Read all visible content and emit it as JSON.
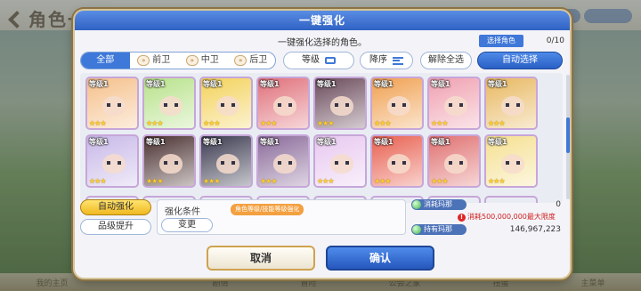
{
  "background": {
    "title": "角色一览",
    "bottom_nav": [
      "我的主页",
      "",
      "剧情",
      "冒险",
      "公会之家",
      "扭蛋",
      "主菜单"
    ]
  },
  "dialog": {
    "title": "一键强化",
    "subtitle": "一键强化选择的角色。",
    "select_label": "选择角色",
    "select_count": "0/10",
    "position_tabs": [
      {
        "label": "全部",
        "icon": ""
      },
      {
        "label": "前卫",
        "icon": "front-position-icon"
      },
      {
        "label": "中卫",
        "icon": "middle-position-icon"
      },
      {
        "label": "后卫",
        "icon": "back-position-icon"
      }
    ],
    "sort_key": "等级",
    "sort_order": "降序",
    "clear_all": "解除全选",
    "auto_select": "自动选择",
    "cards": [
      {
        "level": "等级1",
        "stars": "★★★",
        "color": "#f5c08a"
      },
      {
        "level": "等级1",
        "stars": "★★★",
        "color": "#b7e28a"
      },
      {
        "level": "等级1",
        "stars": "★★★",
        "color": "#f3d25a"
      },
      {
        "level": "等级1",
        "stars": "★★★",
        "color": "#e0707a"
      },
      {
        "level": "等级1",
        "stars": "★★★",
        "color": "#6a4a5a"
      },
      {
        "level": "等级1",
        "stars": "★★★",
        "color": "#f0a050"
      },
      {
        "level": "等级1",
        "stars": "★★★",
        "color": "#f0a0b0"
      },
      {
        "level": "等级1",
        "stars": "★★★",
        "color": "#e8b860"
      },
      {
        "level": "等级1",
        "stars": "★★★",
        "color": "#c8b8e8"
      },
      {
        "level": "等级1",
        "stars": "★★★",
        "color": "#4a3030"
      },
      {
        "level": "等级1",
        "stars": "★★★",
        "color": "#3a3a50"
      },
      {
        "level": "等级1",
        "stars": "★★★",
        "color": "#8a6a9a"
      },
      {
        "level": "等级1",
        "stars": "★★★",
        "color": "#e8c8f0"
      },
      {
        "level": "等级1",
        "stars": "★★★",
        "color": "#e86050"
      },
      {
        "level": "等级1",
        "stars": "★★★",
        "color": "#e07070"
      },
      {
        "level": "等级1",
        "stars": "★★★",
        "color": "#f5e090"
      }
    ],
    "auto_enhance": "自动强化",
    "rank_up": "品级提升",
    "condition_label": "强化条件",
    "condition_change": "变更",
    "condition_tag": "角色等级/技能等级强化",
    "mana_cost_label": "消耗玛那",
    "mana_cost_value": "0",
    "mana_warning": "消耗500,000,000最大限度",
    "mana_owned_label": "持有玛那",
    "mana_owned_value": "146,967,223",
    "cancel": "取消",
    "confirm": "确认"
  }
}
